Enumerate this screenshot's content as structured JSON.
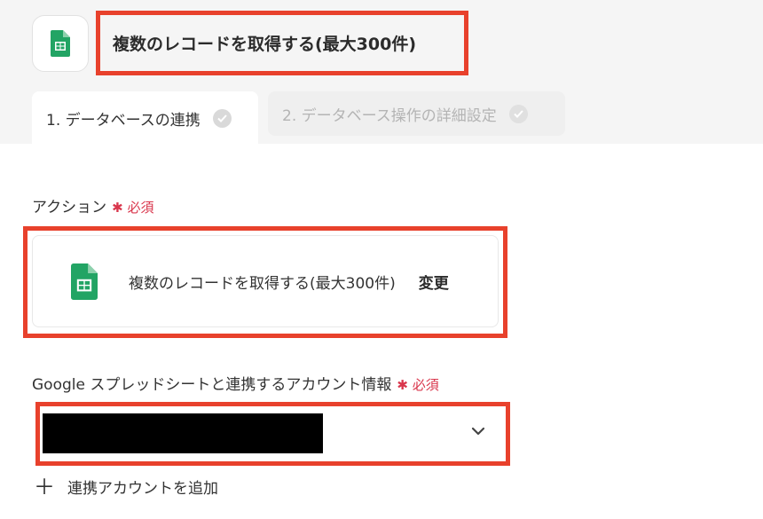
{
  "header": {
    "title": "複数のレコードを取得する(最大300件)",
    "icon": "google-sheets-icon"
  },
  "tabs": [
    {
      "label": "1. データベースの連携",
      "active": true
    },
    {
      "label": "2. データベース操作の詳細設定",
      "active": false
    }
  ],
  "action_field": {
    "label": "アクション",
    "required_label": "必須",
    "value": "複数のレコードを取得する(最大300件)",
    "change_label": "変更"
  },
  "account_field": {
    "label": "Google スプレッドシートと連携するアカウント情報",
    "required_label": "必須",
    "selected_value_redacted": true
  },
  "add_account": {
    "label": "連携アカウントを追加"
  },
  "colors": {
    "highlight": "#e8412c",
    "required": "#d9364c",
    "sheets_green": "#22a464"
  }
}
